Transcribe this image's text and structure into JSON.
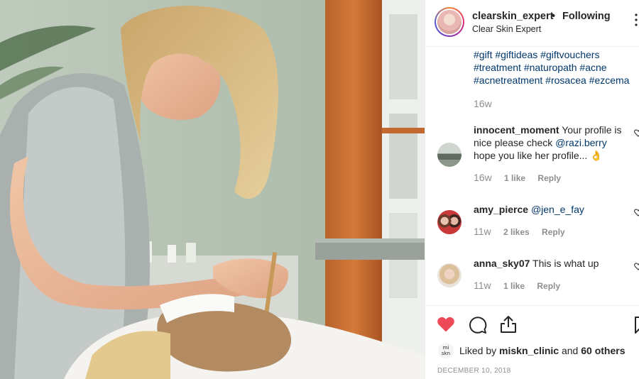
{
  "post": {
    "author": "clearskin_expert",
    "separator": "•",
    "follow_status": "Following",
    "subtitle": "Clear Skin Expert",
    "photo_alt": "Post photo"
  },
  "caption": {
    "lines": [
      "#gift #giftideas #giftvouchers",
      "#treatment #naturopath #acne",
      "#acnetreatment #rosacea #ezcema"
    ],
    "time": "16w"
  },
  "comments": [
    {
      "user": "innocent_moment",
      "text_1": " Your profile is nice please check ",
      "mention": "@razi.berry",
      "text_2": " hope you like her profile... 👌",
      "time": "16w",
      "likes": "1 like",
      "reply": "Reply"
    },
    {
      "user": "amy_pierce",
      "text_1": " ",
      "mention": "@jen_e_fay",
      "text_2": "",
      "time": "11w",
      "likes": "2 likes",
      "reply": "Reply"
    },
    {
      "user": "anna_sky07",
      "text_1": " This is what up",
      "mention": "",
      "text_2": "",
      "time": "11w",
      "likes": "1 like",
      "reply": "Reply"
    }
  ],
  "likes_bar": {
    "avatar_text": "mi\nskn",
    "prefix": "Liked by ",
    "user": "miskn_clinic",
    "middle": " and ",
    "others": "60 others"
  },
  "date": "DECEMBER 10, 2018",
  "colors": {
    "heart_active": "#ed4956",
    "link": "#00376b",
    "muted": "#8e8e8e"
  },
  "icons": [
    "heart-icon",
    "comment-icon",
    "share-icon",
    "bookmark-icon",
    "more-icon"
  ]
}
